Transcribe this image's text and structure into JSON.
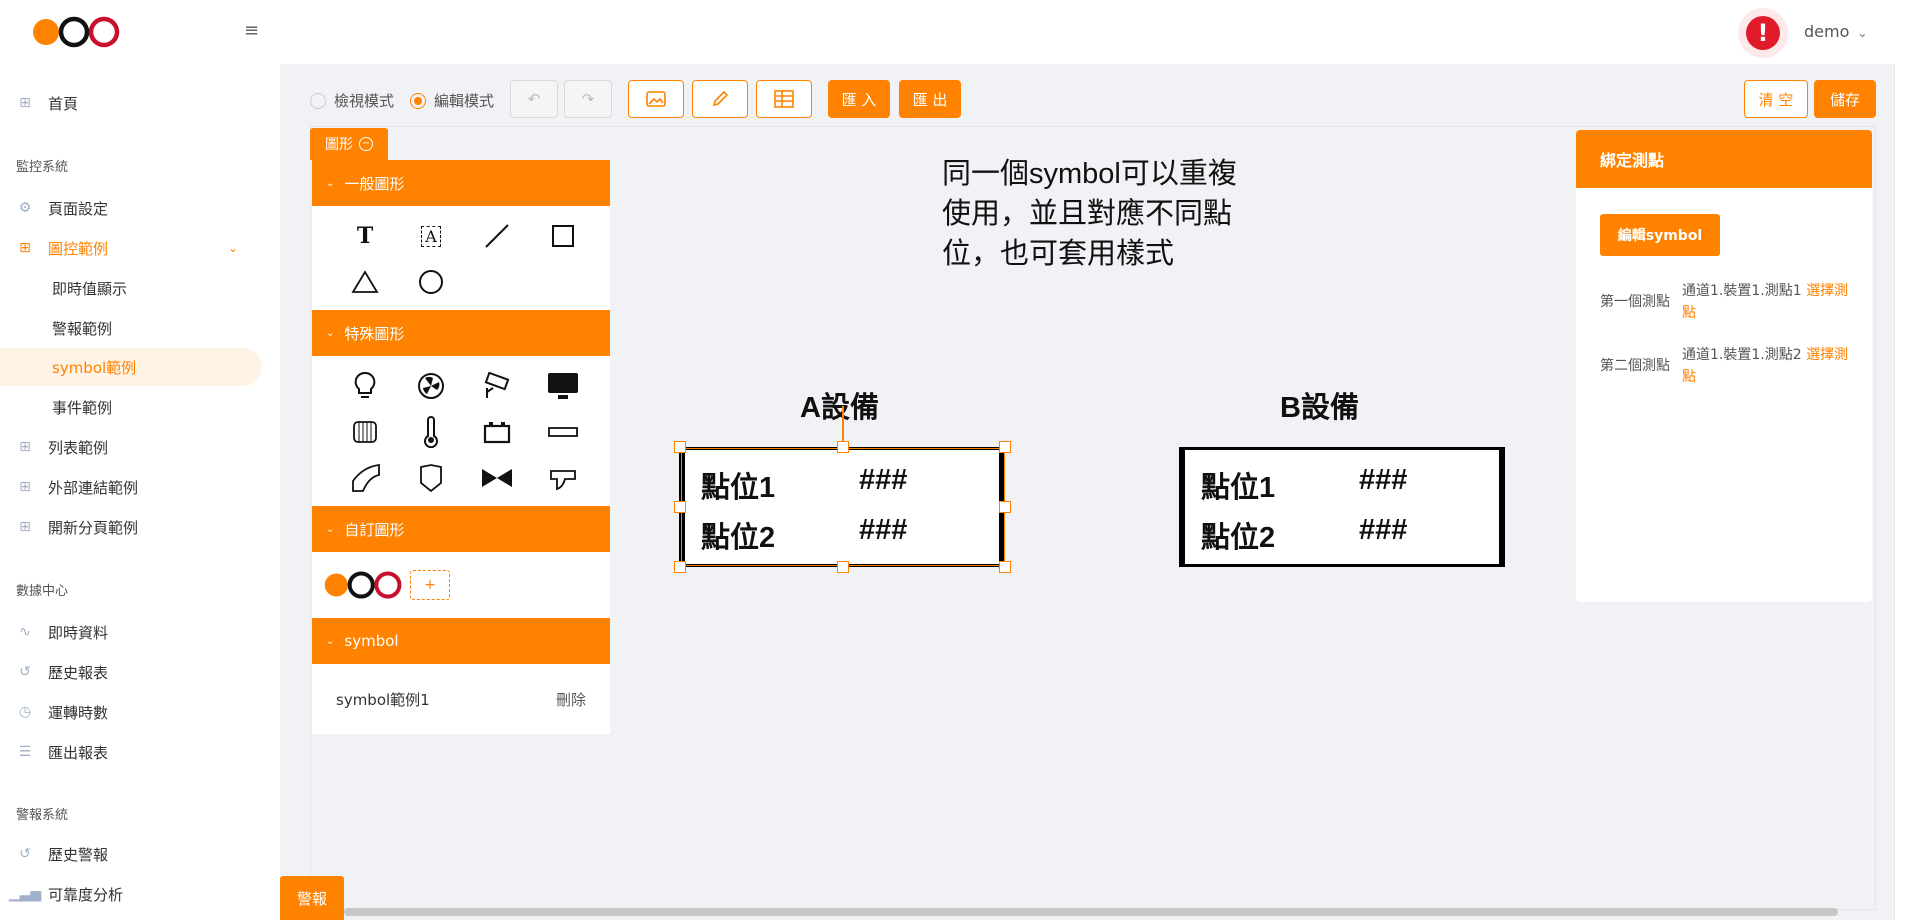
{
  "brand": {
    "logo_text": "OCO",
    "colors": {
      "accent": "#ff8200",
      "logo_orange": "#ff8200",
      "logo_black": "#111111",
      "logo_red": "#c8102e",
      "alert": "#e21b2b"
    }
  },
  "topbar": {
    "menu_icon": "hamburger-icon",
    "alert_icon": "exclamation-icon",
    "user_name": "demo",
    "user_chevron": "⌄"
  },
  "sidebar": {
    "home": "首頁",
    "section_monitor": "監控系統",
    "page_setting": "頁面設定",
    "graphic_examples": "圖控範例",
    "sub_realtime": "即時值顯示",
    "sub_alarm": "警報範例",
    "sub_symbol": "symbol範例",
    "sub_event": "事件範例",
    "list_examples": "列表範例",
    "external_link": "外部連結範例",
    "new_tab": "開新分頁範例",
    "section_data": "數據中心",
    "realtime_data": "即時資料",
    "history_report": "歷史報表",
    "run_hours": "運轉時數",
    "export_report": "匯出報表",
    "section_alarm": "警報系統",
    "history_alarm": "歷史警報",
    "reliability": "可靠度分析"
  },
  "toolbar": {
    "view_mode": "檢視模式",
    "edit_mode": "編輯模式",
    "import": "匯 入",
    "export": "匯 出",
    "clear": "清 空",
    "save": "儲存"
  },
  "shape_tab": "圖形",
  "panel": {
    "general_shapes": "一般圖形",
    "special_shapes": "特殊圖形",
    "custom_shapes": "自訂圖形",
    "symbol": "symbol",
    "add": "+",
    "symbol_item": "symbol範例1",
    "delete": "刪除",
    "text_glyph": "T",
    "textbox_glyph": "A"
  },
  "canvas": {
    "desc_line1": "同一個symbol可以重複",
    "desc_line2": "使用，並且對應不同點",
    "desc_line3": "位，也可套用樣式",
    "equip_a_title": "A設備",
    "equip_b_title": "B設備",
    "point1": "點位1",
    "point2": "點位2",
    "placeholder": "###"
  },
  "bind": {
    "title": "綁定測點",
    "edit_symbol": "編輯symbol",
    "first_label": "第一個測點",
    "first_path": "通道1.裝置1.測點1",
    "second_label": "第二個測點",
    "second_path": "通道1.裝置1.測點2",
    "pick": "選擇測點"
  },
  "footer": {
    "alarm": "警報"
  }
}
